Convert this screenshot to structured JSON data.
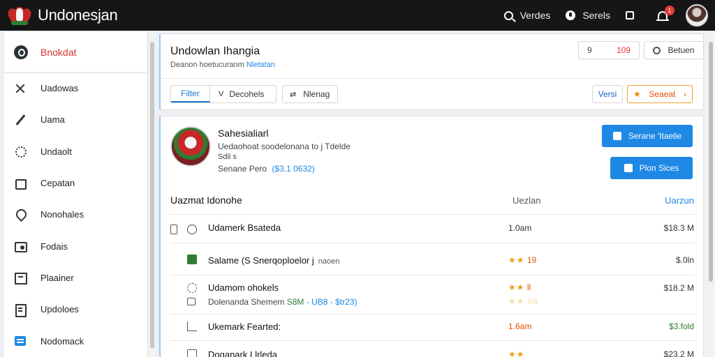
{
  "app": {
    "brand": "Undonesjan"
  },
  "topbar": {
    "items": [
      {
        "label": "Verdes",
        "icon": "search-icon"
      },
      {
        "label": "Serels",
        "icon": "location-icon"
      },
      {
        "label": "",
        "icon": "box-icon"
      }
    ],
    "notif_badge": "1"
  },
  "sidebar": {
    "active": {
      "label": "Bnokdat"
    },
    "items": [
      {
        "label": "Uadowas",
        "icon": "tools-icon"
      },
      {
        "label": "Uama",
        "icon": "pen-icon"
      },
      {
        "label": "Undaolt",
        "icon": "dotted-circle-icon"
      },
      {
        "label": "Cepatan",
        "icon": "calendar-icon"
      },
      {
        "label": "Nonohales",
        "icon": "pin-icon"
      },
      {
        "label": "Fodais",
        "icon": "image-icon"
      },
      {
        "label": "Plaainer",
        "icon": "board-icon"
      },
      {
        "label": "Updoloes",
        "icon": "document-icon"
      },
      {
        "label": "Nodomack",
        "icon": "news-icon"
      }
    ]
  },
  "header": {
    "title": "Undowlan Ihangia",
    "subtitle": "Deanon hoetucuranm",
    "subtitle_highlight": "Nletatan",
    "stats_q": "9",
    "stats_num": "109",
    "user_btn": "Betuen",
    "toolbar": {
      "filter": "Filter",
      "filter_icon": "V",
      "decohels": "Decohels",
      "nlenag": "Nlenag",
      "versi": "Versi",
      "seaeat": "Seaeat",
      "arrow": "›"
    }
  },
  "profile": {
    "name": "Sahesialiarl",
    "desc": "Uedaohoat soodelonana to j Tdelde",
    "desc2": "Sdil s",
    "meta_label": "Senane Pero",
    "meta_value": "($3.1 0632)",
    "btn_primary": "Serane 'Itaelie",
    "btn_secondary": "Plon Sices"
  },
  "table": {
    "headers": [
      "Uazmat Idonohe",
      "Uezlan",
      "Uarzun"
    ],
    "rows": [
      {
        "name": "Udamerk Bsateda",
        "note": "",
        "detail": "",
        "detail_green": "",
        "detail_blue": "",
        "mid": "1.0am",
        "mid_stars": "",
        "mid_stars2": "",
        "rt": "$18.3 M",
        "icon": "search-icon"
      },
      {
        "name": "Salame (S Snerqoploelor j",
        "note": "naoen",
        "detail": "",
        "detail_green": "",
        "detail_blue": "",
        "mid": "19",
        "mid_stars": "★★",
        "mid_stars2": "",
        "rt": "$.0ln",
        "icon": "green-square-icon"
      },
      {
        "name": "Udamom ohokels",
        "note": "",
        "detail": "Dolenanda Shemem",
        "detail_green": "S8M",
        "detail_blue": "- UB8 - $tr23)",
        "mid": "ll",
        "mid_stars": "★★",
        "mid_stars2": "★★ 68",
        "rt": "$18.2 M",
        "icon": "gear-icon"
      },
      {
        "name": "Ukemark Fearted:",
        "note": "",
        "detail": "",
        "detail_green": "",
        "detail_blue": "",
        "mid": "1.6am",
        "mid_stars": "",
        "mid_stars2": "",
        "rt": "$3.fold",
        "icon": "chart-icon"
      },
      {
        "name": "Doganark Llrleda",
        "note": "",
        "detail": "",
        "detail_green": "",
        "detail_blue": "",
        "mid": "",
        "mid_stars": "★★",
        "mid_stars2": "",
        "rt": "$23.2 M",
        "icon": "edit-icon"
      }
    ]
  }
}
